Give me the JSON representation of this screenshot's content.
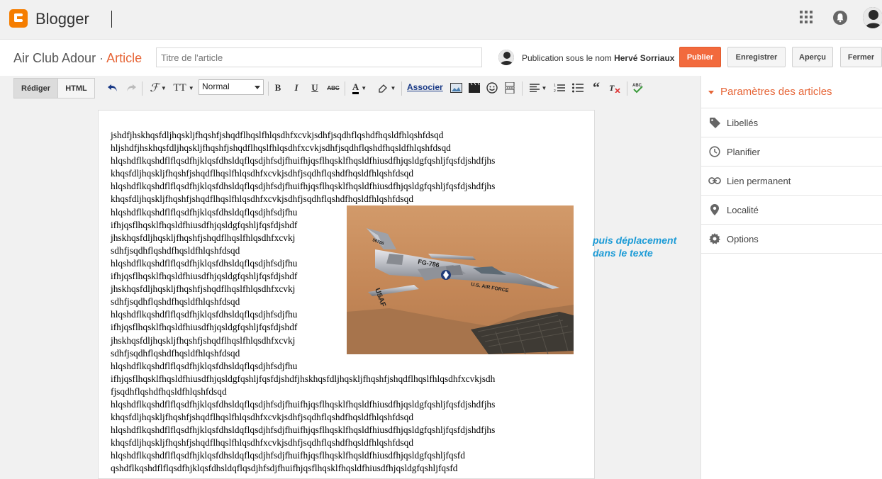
{
  "app": {
    "name": "Blogger"
  },
  "header": {
    "blog_name": "Air Club Adour",
    "separator": "·",
    "section": "Article",
    "title_placeholder": "Titre de l'article",
    "publish_as_prefix": "Publication sous le nom",
    "author": "Hervé Sorriaux",
    "buttons": {
      "publish": "Publier",
      "save": "Enregistrer",
      "preview": "Aperçu",
      "close": "Fermer"
    }
  },
  "toolbar": {
    "mode_compose": "Rédiger",
    "mode_html": "HTML",
    "font_style": "Normal",
    "link_label": "Associer"
  },
  "editor": {
    "lines_full_top": [
      "jshdfjhskhqsfdljhqskljfhqshfjshqdflhqslfhlqsdhfxcvkjsdhfjsqdhflqshdfhqsldfhlqshfdsqd",
      "hljshdfjhskhqsfdljhqskljfhqshfjshqdflhqslfhlqsdhfxcvkjsdhfjsqdhflqshdfhqsldfhlqshfdsqd",
      "hlqshdflkqshdflflqsdfhjklqsfdhsldqflqsdjhfsdjfhuifhjqsflhqsklfhqsldfhiusdfhjqsldgfqshljfqsfdjshdfjhs",
      "khqsfdljhqskljfhqshfjshqdflhqslfhlqsdhfxcvkjsdhfjsqdhflqshdfhqsldfhlqshfdsqd",
      "hlqshdflkqshdflflqsdfhjklqsfdhsldqflqsdjhfsdjfhuifhjqsflhqsklfhqsldfhiusdfhjqsldgfqshljfqsfdjshdfjhs",
      "khqsfdljhqskljfhqshfjshqdflhqslfhlqsdhfxcvkjsdhfjsqdhflqshdfhqsldfhlqshfdsqd"
    ],
    "lines_narrow": [
      "hlqshdflkqshdflflqsdfhjklqsfdhsldqflqsdjhfsdjfhu",
      "ifhjqsflhqsklfhqsldfhiusdfhjqsldgfqshljfqsfdjshdf",
      "jhskhqsfdljhqskljfhqshfjshqdflhqslfhlqsdhfxcvkj",
      "sdhfjsqdhflqshdfhqsldfhlqshfdsqd",
      "hlqshdflkqshdflflqsdfhjklqsfdhsldqflqsdjhfsdjfhu",
      "ifhjqsflhqsklfhqsldfhiusdfhjqsldgfqshljfqsfdjshdf",
      "jhskhqsfdljhqskljfhqshfjshqdflhqslfhlqsdhfxcvkj",
      "sdhfjsqdhflqshdfhqsldfhlqshfdsqd",
      "hlqshdflkqshdflflqsdfhjklqsfdhsldqflqsdjhfsdjfhu",
      "ifhjqsflhqsklfhqsldfhiusdfhjqsldgfqshljfqsfdjshdf",
      "jhskhqsfdljhqskljfhqshfjshqdflhqslfhlqsdhfxcvkj",
      "sdhfjsqdhflqshdfhqsldfhlqshfdsqd",
      "hlqshdflkqshdflflqsdfhjklqsfdhsldqflqsdjhfsdjfhu"
    ],
    "lines_full_bottom": [
      "ifhjqsflhqsklfhqsldfhiusdfhjqsldgfqshljfqsfdjshdfjhskhqsfdljhqskljfhqshfjshqdflhqslfhlqsdhfxcvkjsdh",
      "fjsqdhflqshdfhqsldfhlqshfdsqd",
      "hlqshdflkqshdflflqsdfhjklqsfdhsldqflqsdjhfsdjfhuifhjqsflhqsklfhqsldfhiusdfhjqsldgfqshljfqsfdjshdfjhs",
      "khqsfdljhqskljfhqshfjshqdflhqslfhlqsdhfxcvkjsdhfjsqdhflqshdfhqsldfhlqshfdsqd",
      "hlqshdflkqshdflflqsdfhjklqsfdhsldqflqsdjhfsdjfhuifhjqsflhqsklfhqsldfhiusdfhjqsldgfqshljfqsfdjshdfjhs",
      "khqsfdljhqskljfhqshfjshqdflhqslfhlqsdhfxcvkjsdhfjsqdhflqshdfhqsldfhlqshfdsqd",
      "hlqshdflkqshdflflqsdfhjklqsfdhsldqflqsdjhfsdjfhuifhjqsflhqsklfhqsldfhiusdfhjqsldgfqshljfqsfd",
      "qshdflkqshdflflqsdfhjklqsfdhsldqflqsdjhfsdjfhuifhjqsflhqsklfhqsldfhiusdfhjqsldgfqshljfqsfd"
    ],
    "image": {
      "plane_markings": [
        "U.S. AIR FORCE",
        "FG-786",
        "USAF",
        "56786"
      ]
    }
  },
  "annotation": {
    "line1": "puis déplacement",
    "line2": "dans le texte"
  },
  "sidebar": {
    "heading": "Paramètres des articles",
    "items": [
      {
        "label": "Libellés",
        "icon": "tag-icon"
      },
      {
        "label": "Planifier",
        "icon": "clock-icon"
      },
      {
        "label": "Lien permanent",
        "icon": "link-icon"
      },
      {
        "label": "Localité",
        "icon": "pin-icon"
      },
      {
        "label": "Options",
        "icon": "gear-icon"
      }
    ]
  },
  "colors": {
    "brand_orange": "#f57d00",
    "accent": "#e66537",
    "publish": "#f26a3d",
    "annotation": "#1c9bd6"
  }
}
